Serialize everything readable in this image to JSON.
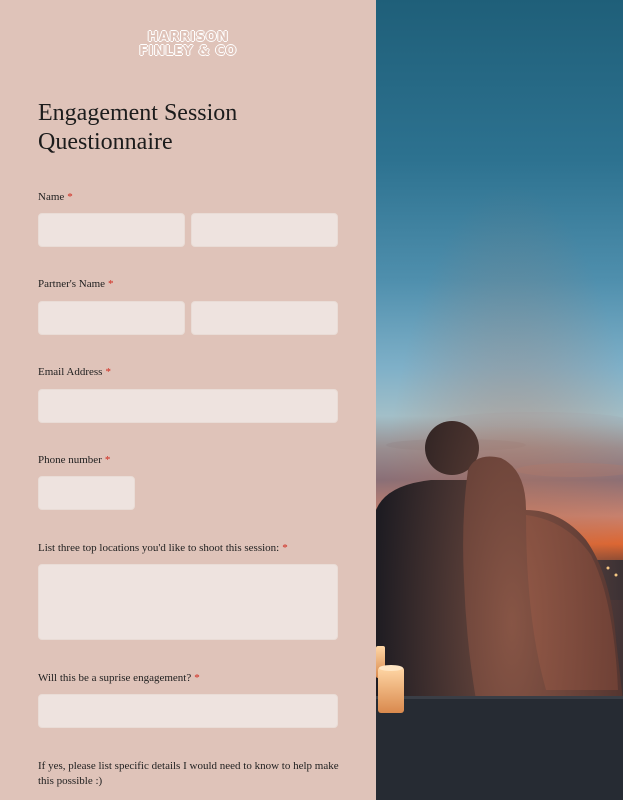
{
  "logo": {
    "line1": "HARRISON",
    "line2": "FINLEY & CO"
  },
  "form": {
    "title_line1": "Engagement Session",
    "title_line2": "Questionnaire",
    "required_marker": "*",
    "fields": {
      "name": {
        "label": "Name"
      },
      "partner_name": {
        "label": "Partner's Name"
      },
      "email": {
        "label": "Email Address"
      },
      "phone": {
        "label": "Phone number"
      },
      "locations": {
        "label": "List three top locations you'd like to shoot this session:"
      },
      "surprise": {
        "label": "Will this be a suprise engagement?"
      },
      "details": {
        "label_line1": "If yes, please list specific details I would need to know to help make",
        "label_line2": "this possible :)"
      }
    }
  },
  "colors": {
    "panel_bg": "#dfc3b9",
    "field_bg": "#eee3df",
    "required": "#d0261b",
    "text": "#1c1c1c"
  }
}
